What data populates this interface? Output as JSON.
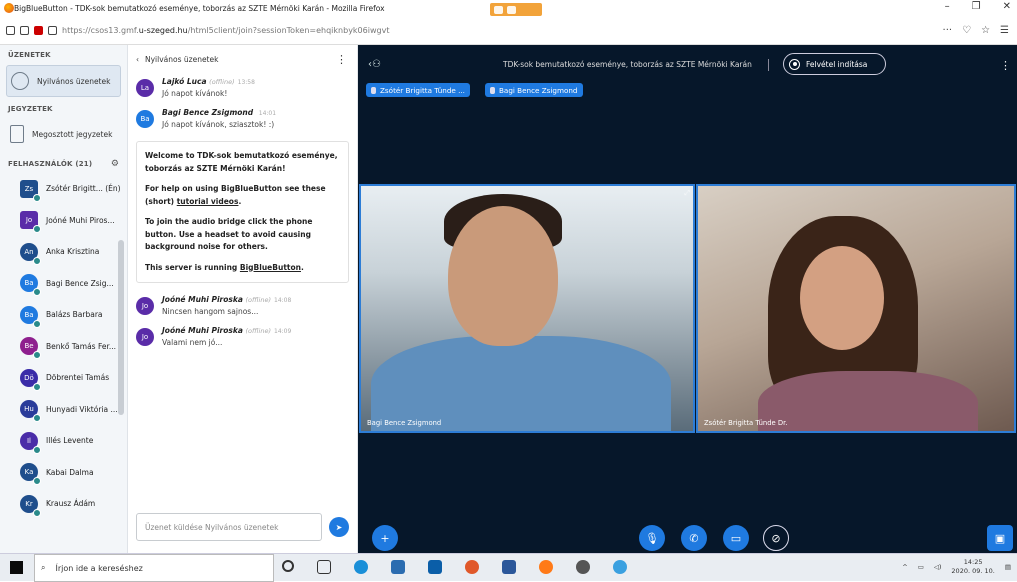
{
  "window": {
    "title": "BigBlueButton - TDK-sok bemutatkozó eseménye, toborzás az SZTE Mérnöki Karán - Mozilla Firefox"
  },
  "browser": {
    "url_prefix": "https://csos13.gmf.",
    "url_domain": "u-szeged.hu",
    "url_suffix": "/html5client/join?sessionToken=ehqiknbyk06iwgvt",
    "menu_glyph": "···"
  },
  "sidebar": {
    "messages_header": "ÜZENETEK",
    "public_chat": "Nyilvános üzenetek",
    "notes_header": "JEGYZETEK",
    "shared_notes": "Megosztott jegyzetek",
    "users_header": "FELHASZNÁLÓK (21)",
    "users": [
      {
        "initials": "Zs",
        "name": "Zsótér Brigitt... (Én)",
        "color": "#1f4e8c",
        "square": true
      },
      {
        "initials": "Jo",
        "name": "Joóné Muhi Piros...",
        "color": "#5a2ca8",
        "square": true
      },
      {
        "initials": "An",
        "name": "Anka Krisztina",
        "color": "#1f4e8c",
        "square": false
      },
      {
        "initials": "Ba",
        "name": "Bagi Bence Zsig...",
        "color": "#1f7ae0",
        "square": false
      },
      {
        "initials": "Ba",
        "name": "Balázs Barbara",
        "color": "#1f7ae0",
        "square": false
      },
      {
        "initials": "Be",
        "name": "Benkő Tamás Fer...",
        "color": "#8e1f8e",
        "square": false
      },
      {
        "initials": "Dö",
        "name": "Döbrentei Tamás",
        "color": "#3a2ca8",
        "square": false
      },
      {
        "initials": "Hu",
        "name": "Hunyadi Viktória ...",
        "color": "#2a3c9a",
        "square": false
      },
      {
        "initials": "Il",
        "name": "Illés Levente",
        "color": "#4a2ca8",
        "square": false
      },
      {
        "initials": "Ka",
        "name": "Kabai Dalma",
        "color": "#1f4e8c",
        "square": false
      },
      {
        "initials": "Kr",
        "name": "Krausz Ádám",
        "color": "#1f4e8c",
        "square": false
      }
    ]
  },
  "chat": {
    "back_label": "Nyilvános üzenetek",
    "messages": [
      {
        "initials": "La",
        "color": "#5a2ca8",
        "name": "Lajkó Luca",
        "status": "(offline)",
        "time": "13:58",
        "text": "Jó napot kívánok!"
      },
      {
        "initials": "Ba",
        "color": "#1f7ae0",
        "name": "Bagi Bence Zsigmond",
        "status": "",
        "time": "14:01",
        "text": "Jó napot kívánok, sziasztok! :)"
      }
    ],
    "welcome": {
      "title": "Welcome to TDK-sok bemutatkozó eseménye, toborzás az SZTE Mérnöki Karán!",
      "help_prefix": "For help on using BigBlueButton see these (short) ",
      "help_link": "tutorial videos",
      "help_suffix": ".",
      "audio": "To join the audio bridge click the phone button. Use a headset to avoid causing background noise for others.",
      "server_prefix": "This server is running ",
      "server_link": "BigBlueButton",
      "server_suffix": "."
    },
    "messages2": [
      {
        "initials": "Jo",
        "color": "#5a2ca8",
        "name": "Joóné Muhi Piroska",
        "status": "(offline)",
        "time": "14:08",
        "text": "Nincsen hangom sajnos..."
      },
      {
        "initials": "Jo",
        "color": "#5a2ca8",
        "name": "Joóné Muhi Piroska",
        "status": "(offline)",
        "time": "14:09",
        "text": "Valami nem jó..."
      }
    ],
    "input_placeholder": "Üzenet küldése Nyilvános üzenetek"
  },
  "main": {
    "title": "TDK-sok bemutatkozó eseménye, toborzás az SZTE Mérnöki Karán",
    "record_label": "Felvétel indítása",
    "talkers": [
      "Zsótér Brigitta Tünde ...",
      "Bagi Bence Zsigmond"
    ],
    "videos": [
      "Bagi Bence Zsigmond",
      "Zsótér Brigitta Tünde Dr."
    ]
  },
  "taskbar": {
    "search_placeholder": "Írjon ide a kereséshez",
    "time": "14:25",
    "date": "2020. 09. 10."
  },
  "colors": {
    "accent": "#1f7ae0",
    "main_bg": "#06172a",
    "sidebar_bg": "#f3f6f9"
  }
}
